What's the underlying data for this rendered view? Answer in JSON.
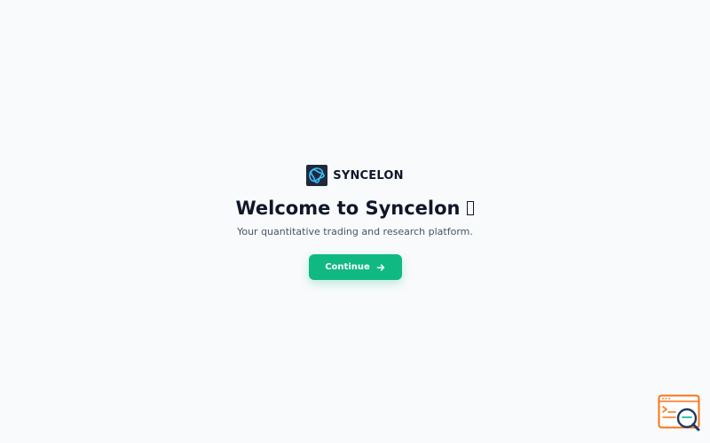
{
  "brand": {
    "name": "SYNCELON",
    "logo_icon": "syncelon-logo-icon"
  },
  "welcome": {
    "title": "Welcome to Syncelon",
    "subtitle": "Your quantitative trading and research platform."
  },
  "actions": {
    "continue_label": "Continue",
    "continue_icon": "arrow-right-icon"
  },
  "colors": {
    "background": "#f8fafc",
    "accent": "#10b981",
    "text_primary": "#0f172a",
    "text_secondary": "#475569",
    "logo_bg": "#1e293b",
    "logo_stroke": "#38bdf8",
    "widget_accent": "#f97316"
  },
  "widget": {
    "icon": "search-console-icon"
  }
}
